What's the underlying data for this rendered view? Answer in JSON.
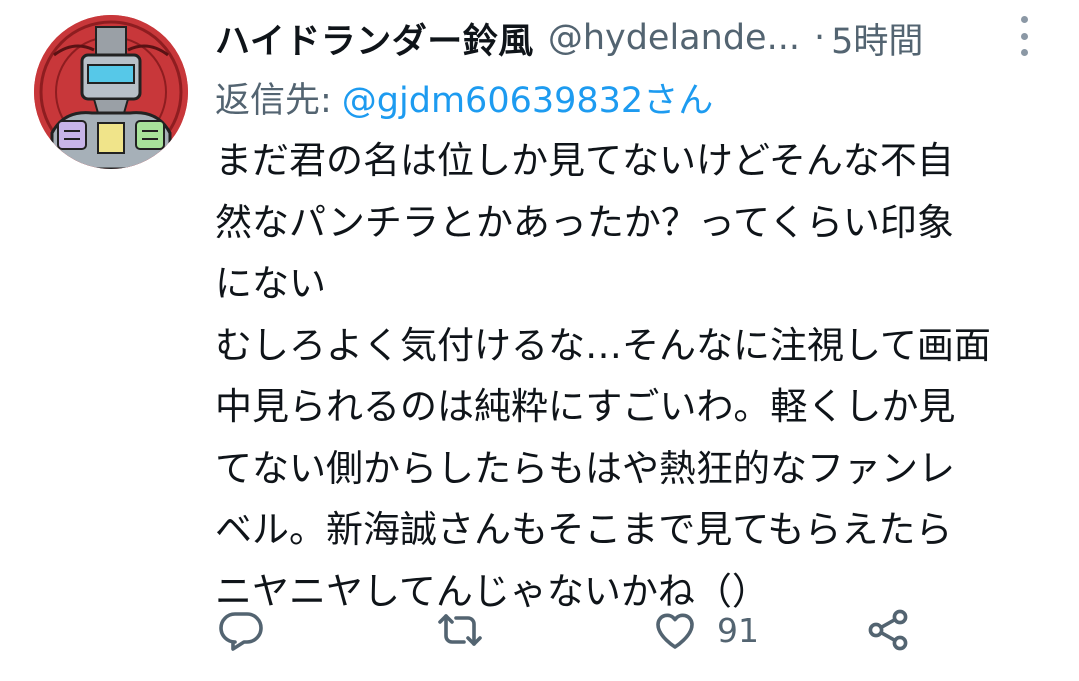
{
  "tweet": {
    "display_name": "ハイドランダー鈴風",
    "handle": "@hydelande...",
    "separator": "·",
    "time": "5時間",
    "reply_prefix": "返信先:",
    "reply_target": "@gjdm60639832さん",
    "body_lines": [
      "まだ君の名は位しか見てないけどそんな不自",
      "然なパンチラとかあったか？ってくらい印象",
      "にない",
      "むしろよく気付けるな…そんなに注視して画面",
      "中見られるのは純粋にすごいわ。軽くしか見",
      "てない側からしたらもはや熱狂的なファンレ",
      "ベル。新海誠さんもそこまで見てもらえたら",
      "ニヤニヤしてんじゃないかね（）"
    ]
  },
  "actions": {
    "reply_icon": "reply-icon",
    "retweet_icon": "retweet-icon",
    "like_icon": "heart-icon",
    "like_count": "91",
    "share_icon": "share-icon"
  },
  "colors": {
    "text": "#0f1419",
    "secondary": "#536471",
    "link": "#1d9bf0",
    "icon": "#536471"
  }
}
